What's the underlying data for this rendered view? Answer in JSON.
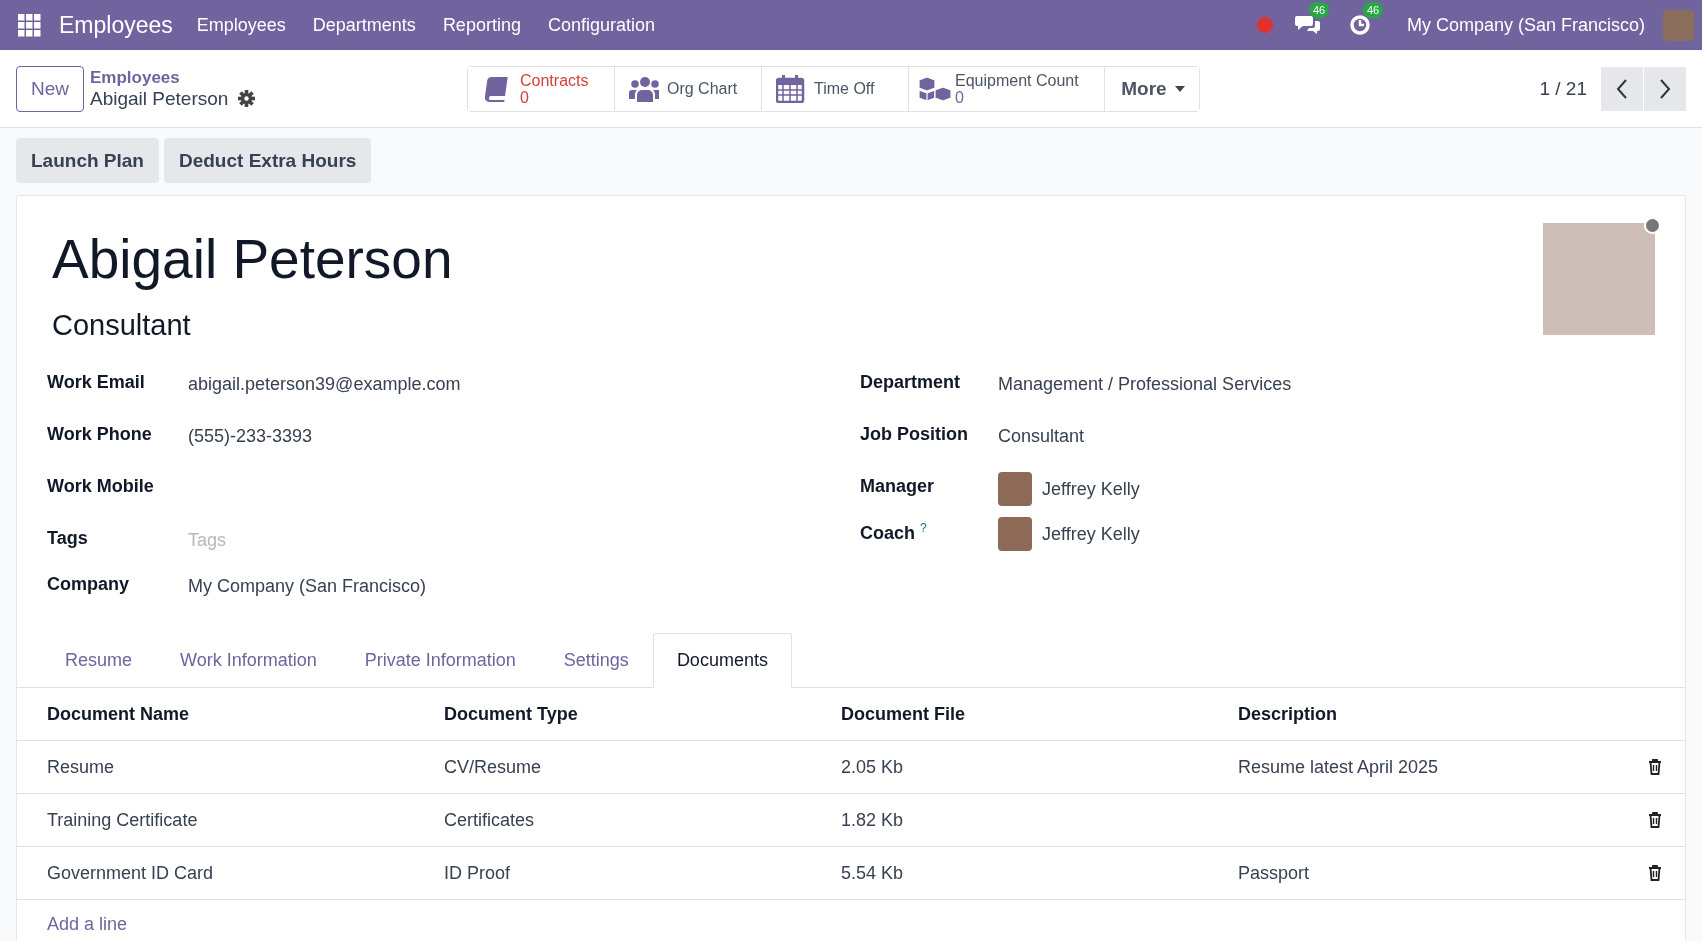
{
  "navbar": {
    "app_name": "Employees",
    "menu": [
      "Employees",
      "Departments",
      "Reporting",
      "Configuration"
    ],
    "recording": true,
    "messages_count": "46",
    "activities_count": "46",
    "company": "My Company (San Francisco)"
  },
  "control_panel": {
    "new_button": "New",
    "breadcrumb": "Employees",
    "record_name": "Abigail Peterson",
    "smart_buttons": [
      {
        "kind": "book",
        "label": "Contracts",
        "value": "0",
        "alert": true
      },
      {
        "kind": "team",
        "label": "Org Chart",
        "alert": false
      },
      {
        "kind": "calendar",
        "label": "Time Off",
        "alert": false
      },
      {
        "kind": "boxes",
        "label": "Equipment Count",
        "value": "0",
        "alert": false
      },
      {
        "kind": "more",
        "label": "More",
        "alert": false
      }
    ],
    "pager": "1 / 21"
  },
  "actions": [
    "Launch Plan",
    "Deduct Extra Hours"
  ],
  "employee": {
    "name": "Abigail Peterson",
    "job_title": "Consultant",
    "online": false
  },
  "left_fields": [
    {
      "kind": "text",
      "label": "Work Email",
      "value": "abigail.peterson39@example.com"
    },
    {
      "kind": "text",
      "label": "Work Phone",
      "value": "(555)-233-3393"
    },
    {
      "kind": "text",
      "label": "Work Mobile"
    },
    {
      "kind": "text",
      "label": "Tags",
      "placeholder": "Tags"
    },
    {
      "kind": "text",
      "label": "Company",
      "value": "My Company (San Francisco)"
    }
  ],
  "right_fields": [
    {
      "kind": "text",
      "label": "Department",
      "value": "Management / Professional Services"
    },
    {
      "kind": "text",
      "label": "Job Position",
      "value": "Consultant"
    },
    {
      "kind": "avatar",
      "label": "Manager",
      "value": "Jeffrey Kelly"
    },
    {
      "kind": "avatar",
      "label": "Coach",
      "help": "?",
      "value": "Jeffrey Kelly"
    }
  ],
  "tabs": [
    {
      "label": "Resume",
      "selected": false
    },
    {
      "label": "Work Information",
      "selected": false
    },
    {
      "label": "Private Information",
      "selected": false
    },
    {
      "label": "Settings",
      "selected": false
    },
    {
      "label": "Documents",
      "selected": true
    }
  ],
  "table": {
    "columns": [
      "Document Name",
      "Document Type",
      "Document File",
      "Description"
    ],
    "rows": [
      [
        "Resume",
        "CV/Resume",
        "2.05 Kb",
        "Resume latest April 2025"
      ],
      [
        "Training Certificate",
        "Certificates",
        "1.82 Kb",
        ""
      ],
      [
        "Government ID Card",
        "ID Proof",
        "5.54 Kb",
        "Passport"
      ]
    ],
    "add_line": "Add a line"
  }
}
